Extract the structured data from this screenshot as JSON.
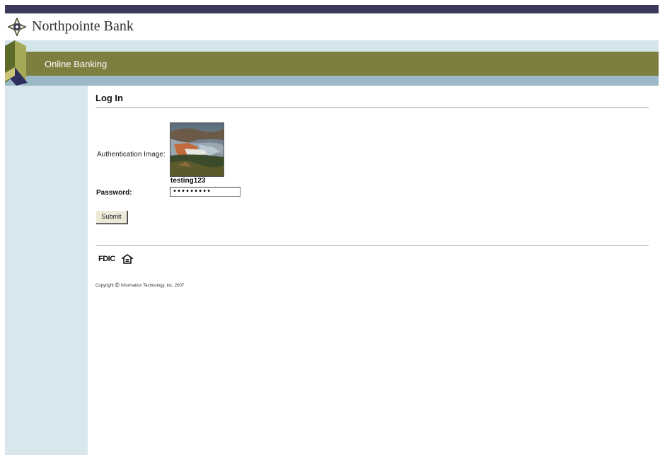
{
  "brand": {
    "bank_name": "Northpointe Bank",
    "logo_icon": "compass-rose-icon"
  },
  "header": {
    "section_label": "Online Banking"
  },
  "login": {
    "title": "Log In",
    "auth_image_label": "Authentication Image:",
    "auth_image_caption": "testing123",
    "password_label": "Password:",
    "password_value": "•••••••••",
    "submit_label": "Submit"
  },
  "footer": {
    "fdic_label": "FDIC",
    "equal_housing_icon": "equal-housing-icon",
    "copyright_prefix": "Copyright",
    "copyright_symbol": "©",
    "copyright_text": "Information Technology, Inc. 2007"
  },
  "colors": {
    "top_bar": "#3b3a5c",
    "olive_band": "#7c7f3f",
    "light_band": "#d3e4ea",
    "lower_band": "#9ab8c6",
    "sidebar": "#d8e6ee"
  }
}
